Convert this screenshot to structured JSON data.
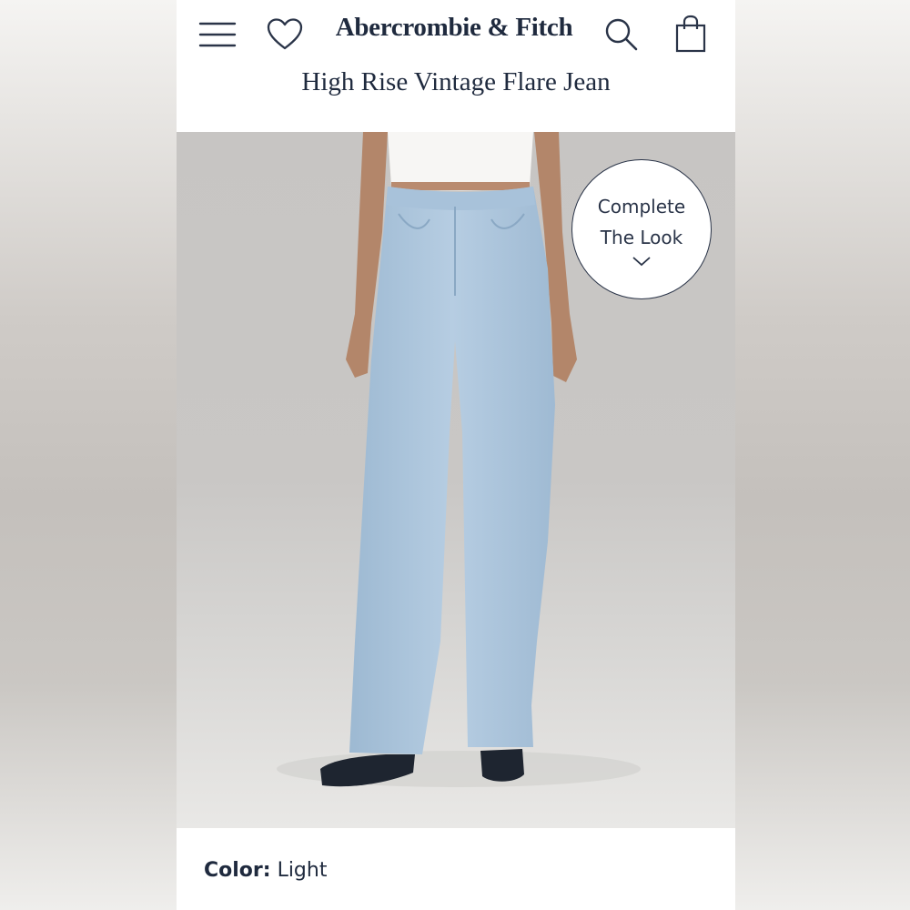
{
  "header": {
    "brand": "Abercrombie & Fitch",
    "product_title": "High Rise Vintage Flare Jean",
    "icons": [
      "menu-icon",
      "heart-icon",
      "search-icon",
      "shopping-bag-icon"
    ]
  },
  "photo": {
    "complete_the_look_line1": "Complete",
    "complete_the_look_line2": "The Look"
  },
  "details": {
    "color_label": "Color:",
    "color_value": "Light"
  },
  "colors": {
    "brand_navy": "#1f2a3e",
    "denim": "#a9c4dc"
  }
}
